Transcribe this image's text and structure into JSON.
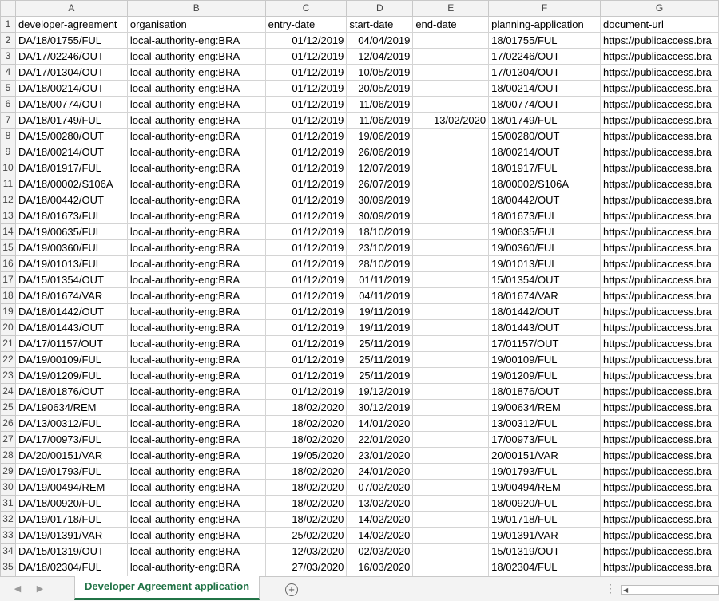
{
  "columns": [
    "A",
    "B",
    "C",
    "D",
    "E",
    "F",
    "G"
  ],
  "numeric_columns": [
    2,
    3,
    4
  ],
  "header_row": [
    "developer-agreement",
    "organisation",
    "entry-date",
    "start-date",
    "end-date",
    "planning-application",
    "document-url"
  ],
  "rows": [
    [
      "DA/18/01755/FUL",
      "local-authority-eng:BRA",
      "01/12/2019",
      "04/04/2019",
      "",
      "18/01755/FUL",
      "https://publicaccess.bra"
    ],
    [
      "DA/17/02246/OUT",
      "local-authority-eng:BRA",
      "01/12/2019",
      "12/04/2019",
      "",
      "17/02246/OUT",
      "https://publicaccess.bra"
    ],
    [
      "DA/17/01304/OUT",
      "local-authority-eng:BRA",
      "01/12/2019",
      "10/05/2019",
      "",
      "17/01304/OUT",
      "https://publicaccess.bra"
    ],
    [
      "DA/18/00214/OUT",
      "local-authority-eng:BRA",
      "01/12/2019",
      "20/05/2019",
      "",
      "18/00214/OUT",
      "https://publicaccess.bra"
    ],
    [
      "DA/18/00774/OUT",
      "local-authority-eng:BRA",
      "01/12/2019",
      "11/06/2019",
      "",
      "18/00774/OUT",
      "https://publicaccess.bra"
    ],
    [
      "DA/18/01749/FUL",
      "local-authority-eng:BRA",
      "01/12/2019",
      "11/06/2019",
      "13/02/2020",
      "18/01749/FUL",
      "https://publicaccess.bra"
    ],
    [
      "DA/15/00280/OUT",
      "local-authority-eng:BRA",
      "01/12/2019",
      "19/06/2019",
      "",
      "15/00280/OUT",
      "https://publicaccess.bra"
    ],
    [
      "DA/18/00214/OUT",
      "local-authority-eng:BRA",
      "01/12/2019",
      "26/06/2019",
      "",
      "18/00214/OUT",
      "https://publicaccess.bra"
    ],
    [
      "DA/18/01917/FUL",
      "local-authority-eng:BRA",
      "01/12/2019",
      "12/07/2019",
      "",
      "18/01917/FUL",
      "https://publicaccess.bra"
    ],
    [
      "DA/18/00002/S106A",
      "local-authority-eng:BRA",
      "01/12/2019",
      "26/07/2019",
      "",
      "18/00002/S106A",
      "https://publicaccess.bra"
    ],
    [
      "DA/18/00442/OUT",
      "local-authority-eng:BRA",
      "01/12/2019",
      "30/09/2019",
      "",
      "18/00442/OUT",
      "https://publicaccess.bra"
    ],
    [
      "DA/18/01673/FUL",
      "local-authority-eng:BRA",
      "01/12/2019",
      "30/09/2019",
      "",
      "18/01673/FUL",
      "https://publicaccess.bra"
    ],
    [
      "DA/19/00635/FUL",
      "local-authority-eng:BRA",
      "01/12/2019",
      "18/10/2019",
      "",
      "19/00635/FUL",
      "https://publicaccess.bra"
    ],
    [
      "DA/19/00360/FUL",
      "local-authority-eng:BRA",
      "01/12/2019",
      "23/10/2019",
      "",
      "19/00360/FUL",
      "https://publicaccess.bra"
    ],
    [
      "DA/19/01013/FUL",
      "local-authority-eng:BRA",
      "01/12/2019",
      "28/10/2019",
      "",
      "19/01013/FUL",
      "https://publicaccess.bra"
    ],
    [
      "DA/15/01354/OUT",
      "local-authority-eng:BRA",
      "01/12/2019",
      "01/11/2019",
      "",
      "15/01354/OUT",
      "https://publicaccess.bra"
    ],
    [
      "DA/18/01674/VAR",
      "local-authority-eng:BRA",
      "01/12/2019",
      "04/11/2019",
      "",
      "18/01674/VAR",
      "https://publicaccess.bra"
    ],
    [
      "DA/18/01442/OUT",
      "local-authority-eng:BRA",
      "01/12/2019",
      "19/11/2019",
      "",
      "18/01442/OUT",
      "https://publicaccess.bra"
    ],
    [
      "DA/18/01443/OUT",
      "local-authority-eng:BRA",
      "01/12/2019",
      "19/11/2019",
      "",
      "18/01443/OUT",
      "https://publicaccess.bra"
    ],
    [
      "DA/17/01157/OUT",
      "local-authority-eng:BRA",
      "01/12/2019",
      "25/11/2019",
      "",
      "17/01157/OUT",
      "https://publicaccess.bra"
    ],
    [
      "DA/19/00109/FUL",
      "local-authority-eng:BRA",
      "01/12/2019",
      "25/11/2019",
      "",
      "19/00109/FUL",
      "https://publicaccess.bra"
    ],
    [
      "DA/19/01209/FUL",
      "local-authority-eng:BRA",
      "01/12/2019",
      "25/11/2019",
      "",
      "19/01209/FUL",
      "https://publicaccess.bra"
    ],
    [
      "DA/18/01876/OUT",
      "local-authority-eng:BRA",
      "01/12/2019",
      "19/12/2019",
      "",
      "18/01876/OUT",
      "https://publicaccess.bra"
    ],
    [
      "DA/190634/REM",
      "local-authority-eng:BRA",
      "18/02/2020",
      "30/12/2019",
      "",
      "19/00634/REM",
      "https://publicaccess.bra"
    ],
    [
      "DA/13/00312/FUL",
      "local-authority-eng:BRA",
      "18/02/2020",
      "14/01/2020",
      "",
      "13/00312/FUL",
      "https://publicaccess.bra"
    ],
    [
      "DA/17/00973/FUL",
      "local-authority-eng:BRA",
      "18/02/2020",
      "22/01/2020",
      "",
      "17/00973/FUL",
      "https://publicaccess.bra"
    ],
    [
      "DA/20/00151/VAR",
      "local-authority-eng:BRA",
      "19/05/2020",
      "23/01/2020",
      "",
      "20/00151/VAR",
      "https://publicaccess.bra"
    ],
    [
      "DA/19/01793/FUL",
      "local-authority-eng:BRA",
      "18/02/2020",
      "24/01/2020",
      "",
      "19/01793/FUL",
      "https://publicaccess.bra"
    ],
    [
      "DA/19/00494/REM",
      "local-authority-eng:BRA",
      "18/02/2020",
      "07/02/2020",
      "",
      "19/00494/REM",
      "https://publicaccess.bra"
    ],
    [
      "DA/18/00920/FUL",
      "local-authority-eng:BRA",
      "18/02/2020",
      "13/02/2020",
      "",
      "18/00920/FUL",
      "https://publicaccess.bra"
    ],
    [
      "DA/19/01718/FUL",
      "local-authority-eng:BRA",
      "18/02/2020",
      "14/02/2020",
      "",
      "19/01718/FUL",
      "https://publicaccess.bra"
    ],
    [
      "DA/19/01391/VAR",
      "local-authority-eng:BRA",
      "25/02/2020",
      "14/02/2020",
      "",
      "19/01391/VAR",
      "https://publicaccess.bra"
    ],
    [
      "DA/15/01319/OUT",
      "local-authority-eng:BRA",
      "12/03/2020",
      "02/03/2020",
      "",
      "15/01319/OUT",
      "https://publicaccess.bra"
    ],
    [
      "DA/18/02304/FUL",
      "local-authority-eng:BRA",
      "27/03/2020",
      "16/03/2020",
      "",
      "18/02304/FUL",
      "https://publicaccess.bra"
    ]
  ],
  "sheet": {
    "active_tab": "Developer Agreement application",
    "add_sheet_icon": "plus-circle-icon",
    "prev_icon": "triangle-left-icon",
    "next_icon": "triangle-right-icon",
    "accent_color": "#217346"
  }
}
